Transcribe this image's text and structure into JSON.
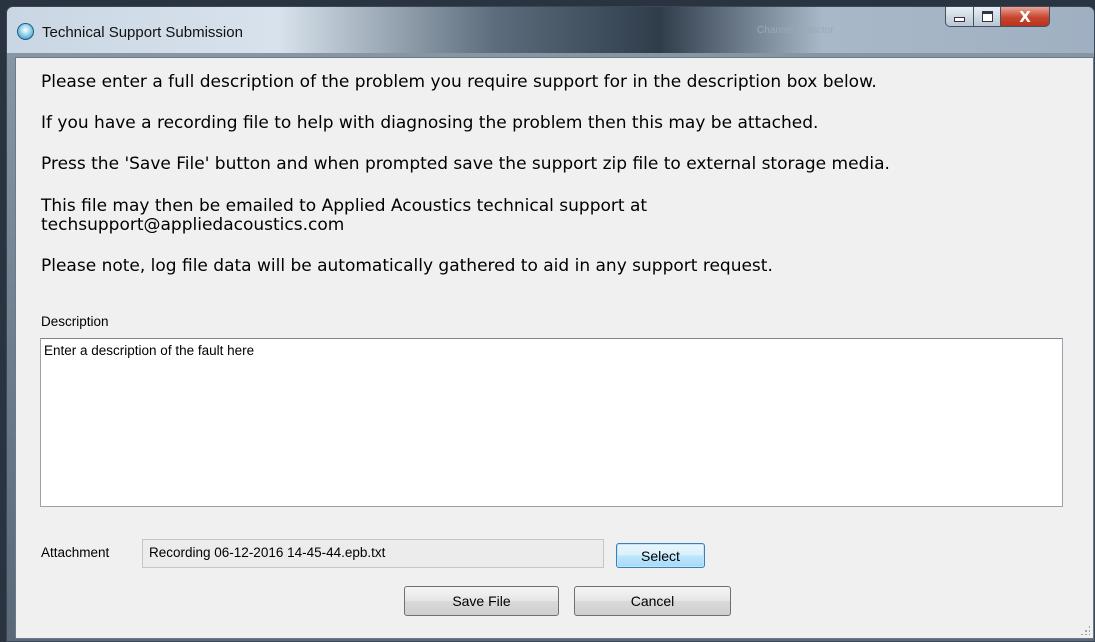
{
  "window": {
    "title": "Technical Support Submission",
    "background_label": "Channel Selector",
    "close_glyph": "X"
  },
  "instructions": [
    "Please enter a full description of the problem you require support for in the description box below.",
    "If you have a recording file to help with diagnosing the problem then this may be attached.",
    "Press the 'Save File' button and when prompted save the support zip file to external storage media.",
    "This file may then be emailed to Applied Acoustics technical support at",
    "techsupport@appliedacoustics.com",
    "Please note, log file data will be automatically gathered to aid in any support request."
  ],
  "description": {
    "label": "Description",
    "value": "Enter a description of the fault here"
  },
  "attachment": {
    "label": "Attachment",
    "value": "Recording 06-12-2016 14-45-44.epb.txt",
    "select_label": "Select"
  },
  "buttons": {
    "save_label": "Save File",
    "cancel_label": "Cancel"
  },
  "colors": {
    "close_button": "#c7452e",
    "select_button_border": "#3c7fb1",
    "client_background": "#f0f0f0"
  }
}
